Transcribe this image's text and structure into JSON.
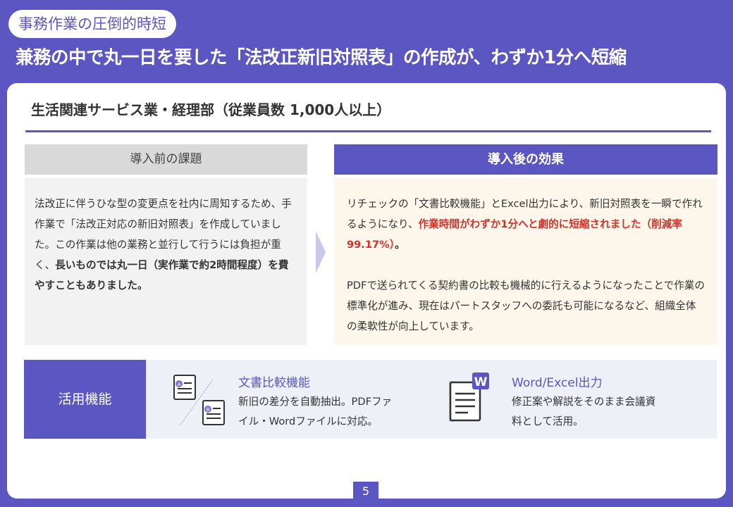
{
  "header": {
    "tag": "事務作業の圧倒的時短",
    "headline": "兼務の中で丸一日を要した「法改正新旧対照表」の作成が、わずか1分へ短縮"
  },
  "case": {
    "title": "生活関連サービス業・経理部（従業員数 1,000人以上）"
  },
  "before": {
    "heading": "導入前の課題",
    "text": "法改正に伴うひな型の変更点を社内に周知するため、手作業で「法改正対応の新旧対照表」を作成していました。この作業は他の業務と並行して行うには負担が重く、",
    "bold": "長いものでは丸一日（実作業で約2時間程度）を費やすこともありました。"
  },
  "after": {
    "heading": "導入後の効果",
    "p1_pre": "リチェックの「文書比較機能」とExcel出力により、新旧対照表を一瞬で作れるようになり、",
    "p1_red": "作業時間がわずか1分へと劇的に短縮されました（削減率99.17%）",
    "p1_post": "。",
    "p2": "PDFで送られてくる契約書の比較も機械的に行えるようになったことで作業の標準化が進み、現在はパートスタッフへの委託も可能になるなど、組織全体の柔軟性が向上しています。"
  },
  "features": {
    "label": "活用機能",
    "items": [
      {
        "title": "文書比較機能",
        "desc_line1": "新旧の差分を自動抽出。PDFファ",
        "desc_line2": "イル・Wordファイルに対応。",
        "icon": "document-compare-icon",
        "badge_a": "A",
        "badge_b": "B"
      },
      {
        "title": "Word/Excel出力",
        "desc_line1": "修正案や解説をそのまま会議資",
        "desc_line2": "料として活用。",
        "icon": "word-document-icon",
        "badge_w": "W"
      }
    ]
  },
  "page": {
    "number": "5"
  },
  "colors": {
    "accent": "#5b56c2",
    "highlight_red": "#d0332b",
    "after_bg": "#fdf6ea",
    "before_bg": "#f2f2f2"
  }
}
